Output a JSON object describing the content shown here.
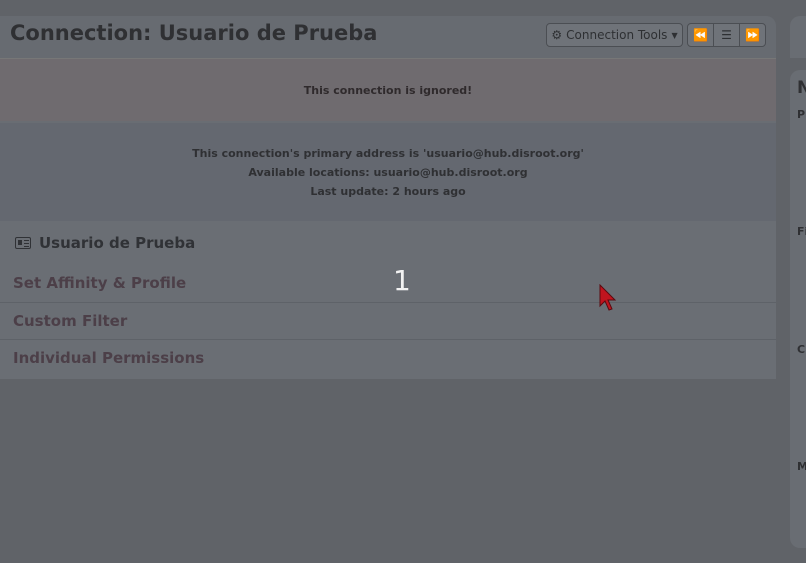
{
  "header": {
    "title": "Connection: Usuario de Prueba",
    "tools_label": "Connection Tools"
  },
  "alert": {
    "message": "This connection is ignored!"
  },
  "info": {
    "primary_address": "This connection's primary address is 'usuario@hub.disroot.org'",
    "locations": "Available locations: usuario@hub.disroot.org",
    "last_update": "Last update: 2 hours ago"
  },
  "section": {
    "contact_name": "Usuario de Prueba",
    "links": [
      {
        "label": "Set Affinity & Profile"
      },
      {
        "label": "Custom Filter"
      },
      {
        "label": "Individual Permissions"
      }
    ]
  },
  "overlay": {
    "number": "1"
  },
  "right_panel": {
    "letters": [
      "N",
      "P",
      "Fi",
      "C",
      "M"
    ]
  },
  "colors": {
    "cursor": "#c0141e"
  }
}
